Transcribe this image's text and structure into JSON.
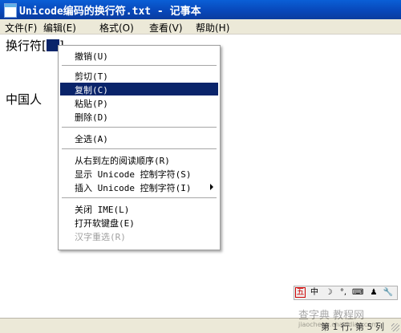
{
  "window": {
    "title": "Unicode编码的换行符.txt - 记事本"
  },
  "menubar": [
    {
      "label": "文件(F)"
    },
    {
      "label": "编辑(E)"
    },
    {
      "label": "格式(O)"
    },
    {
      "label": "查看(V)"
    },
    {
      "label": "帮助(H)"
    }
  ],
  "editor": {
    "line1": "换行符[",
    "line1_close": "]",
    "line2": "中国人"
  },
  "context_menu": {
    "highlighted_item": "复制(C)",
    "items": [
      {
        "label": "撤销(U)",
        "enabled": true
      },
      {
        "label": "剪切(T)",
        "enabled": true
      },
      {
        "label": "复制(C)",
        "enabled": true
      },
      {
        "label": "粘贴(P)",
        "enabled": true
      },
      {
        "label": "删除(D)",
        "enabled": true
      },
      {
        "label": "全选(A)",
        "enabled": true
      },
      {
        "label": "从右到左的阅读顺序(R)",
        "enabled": true
      },
      {
        "label": "显示 Unicode 控制字符(S)",
        "enabled": true
      },
      {
        "label": "插入 Unicode 控制字符(I)",
        "enabled": true,
        "submenu": true
      },
      {
        "label": "关闭 IME(L)",
        "enabled": true
      },
      {
        "label": "打开软键盘(E)",
        "enabled": true
      },
      {
        "label": "汉字重选(R)",
        "enabled": false
      }
    ]
  },
  "ime_toolbar": {
    "icons": [
      "五",
      "中",
      "☽",
      "°,",
      "⌨",
      "♟",
      "🔧"
    ]
  },
  "statusbar": {
    "position": "第 1 行, 第 5 列"
  },
  "watermark": {
    "text": "查字典 教程网",
    "url": "jiaocheng.chazidian.com"
  },
  "colors": {
    "titlebar": "#0846b8",
    "highlight": "#0a246a",
    "face": "#ece9d8"
  }
}
